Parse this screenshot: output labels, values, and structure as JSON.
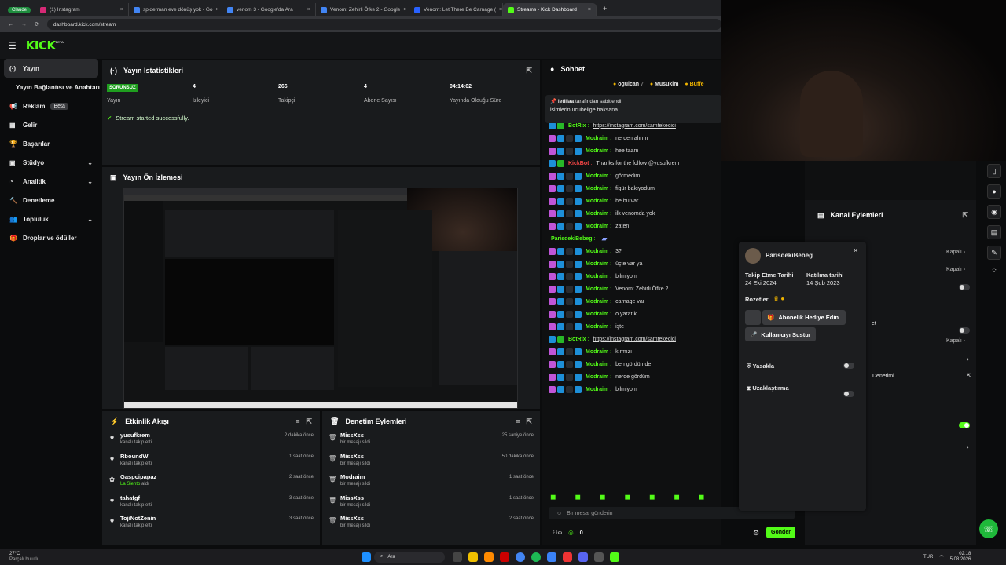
{
  "browser": {
    "tabs": [
      {
        "label": "Claude",
        "color": "#1e8e3e",
        "group": true
      },
      {
        "label": "(1) Instagram",
        "color": "#d62976"
      },
      {
        "label": "spiderman eve dönüş yok - Go",
        "color": "#4285f4"
      },
      {
        "label": "venom 3 - Google'da Ara",
        "color": "#4285f4"
      },
      {
        "label": "Venom: Zehirli Öfke 2 - Google",
        "color": "#4285f4"
      },
      {
        "label": "Venom: Let There Be Carnage (",
        "color": "#2962ff"
      },
      {
        "label": "Streams - Kick Dashboard",
        "color": "#53fc18",
        "active": true
      }
    ],
    "url": "dashboard.kick.com/stream"
  },
  "brand": {
    "logo": "KICK",
    "beta": "BETA",
    "accent": "#53fc18"
  },
  "sidebar": {
    "items": [
      {
        "label": "Yayın",
        "icon": "broadcast-icon",
        "active": true
      },
      {
        "label": "Yayın Bağlantısı ve Anahtarı",
        "icon": ""
      },
      {
        "label": "Reklam",
        "icon": "megaphone-icon",
        "badge": "Beta"
      },
      {
        "label": "Gelir",
        "icon": "money-icon"
      },
      {
        "label": "Başarılar",
        "icon": "trophy-icon"
      },
      {
        "label": "Stüdyo",
        "icon": "studio-icon",
        "chevron": true
      },
      {
        "label": "Analitik",
        "icon": "analytics-icon",
        "chevron": true
      },
      {
        "label": "Denetleme",
        "icon": "hammer-icon"
      },
      {
        "label": "Topluluk",
        "icon": "community-icon",
        "chevron": true
      },
      {
        "label": "Droplar ve ödüller",
        "icon": "gift-icon"
      }
    ]
  },
  "stats": {
    "title": "Yayın İstatistikleri",
    "status_badge": "SORUNSUZ",
    "items": [
      {
        "value": "",
        "label": "Yayın"
      },
      {
        "value": "4",
        "label": "İzleyici"
      },
      {
        "value": "266",
        "label": "Takipçi"
      },
      {
        "value": "4",
        "label": "Abone Sayısı"
      },
      {
        "value": "04:14:02",
        "label": "Yayında Olduğu Süre"
      }
    ],
    "success": "Stream started successfully."
  },
  "preview": {
    "title": "Yayın Ön İzlemesi"
  },
  "feed": {
    "title": "Etkinlik Akışı",
    "rows": [
      {
        "name": "yusufkrem",
        "sub": "kanalı takip etti",
        "time": "2 dakika önce",
        "icon": "heart-icon"
      },
      {
        "name": "RboundW",
        "sub": "kanalı takip etti",
        "time": "1 saat önce",
        "icon": "heart-icon"
      },
      {
        "name": "Gaspcipapaz",
        "sub": "La Siento",
        "sub2": "aldı",
        "time": "2 saat önce",
        "icon": "gift-icon"
      },
      {
        "name": "tahafgf",
        "sub": "kanalı takip etti",
        "time": "3 saat önce",
        "icon": "heart-icon"
      },
      {
        "name": "TojiNotZenin",
        "sub": "kanalı takip etti",
        "time": "3 saat önce",
        "icon": "heart-icon"
      }
    ]
  },
  "mod": {
    "title": "Denetim Eylemleri",
    "rows": [
      {
        "name": "MissXss",
        "sub": "bir mesajı sildi",
        "time": "25 saniye önce"
      },
      {
        "name": "MissXss",
        "sub": "bir mesajı sildi",
        "time": "50 dakika önce"
      },
      {
        "name": "Modraim",
        "sub": "bir mesajı sildi",
        "time": "1 saat önce"
      },
      {
        "name": "MissXss",
        "sub": "bir mesajı sildi",
        "time": "1 saat önce"
      },
      {
        "name": "MissXss",
        "sub": "bir mesajı sildi",
        "time": "2 saat önce"
      }
    ]
  },
  "chat": {
    "title": "Sohbet",
    "top_users": [
      "ogulcan",
      "Musukim",
      "Buffe"
    ],
    "top_counts": [
      "7",
      ""
    ],
    "pinned_by": "letlilaa",
    "pinned_label": "tarafından sabitlendi",
    "pinned_text": "isimlerin ucubelige baksana",
    "messages": [
      {
        "user": "BotRix",
        "text": "https://instagram.com/samtekecici",
        "link": true,
        "badges": [
          "b2",
          "b4"
        ]
      },
      {
        "user": "Modraim",
        "text": "nerden alırım",
        "badges": [
          "b1",
          "b2",
          "b3",
          "b2"
        ]
      },
      {
        "user": "Modraim",
        "text": "hee taam",
        "badges": [
          "b1",
          "b2",
          "b3",
          "b2"
        ]
      },
      {
        "user": "KickBot",
        "text": "Thanks for the follow @yusufkrem",
        "red": true,
        "badges": [
          "b2",
          "b4"
        ]
      },
      {
        "user": "Modraim",
        "text": "görmedim",
        "badges": [
          "b1",
          "b2",
          "b3",
          "b2"
        ]
      },
      {
        "user": "Modraim",
        "text": "figür bakıyodum",
        "badges": [
          "b1",
          "b2",
          "b3",
          "b2"
        ]
      },
      {
        "user": "Modraim",
        "text": "he bu var",
        "badges": [
          "b1",
          "b2",
          "b3",
          "b2"
        ]
      },
      {
        "user": "Modraim",
        "text": "ilk venomda yok",
        "badges": [
          "b1",
          "b2",
          "b3",
          "b2"
        ]
      },
      {
        "user": "Modraim",
        "text": "zaten",
        "badges": [
          "b1",
          "b2",
          "b3",
          "b2"
        ]
      },
      {
        "user": "ParisdekiBebeg",
        "text": "",
        "badges": []
      },
      {
        "user": "Modraim",
        "text": "3?",
        "badges": [
          "b1",
          "b2",
          "b3",
          "b2"
        ]
      },
      {
        "user": "Modraim",
        "text": "üçte var ya",
        "badges": [
          "b1",
          "b2",
          "b3",
          "b2"
        ]
      },
      {
        "user": "Modraim",
        "text": "bilmiyom",
        "badges": [
          "b1",
          "b2",
          "b3",
          "b2"
        ]
      },
      {
        "user": "Modraim",
        "text": "Venom: Zehirli Öfke 2",
        "badges": [
          "b1",
          "b2",
          "b3",
          "b2"
        ]
      },
      {
        "user": "Modraim",
        "text": "carnage var",
        "badges": [
          "b1",
          "b2",
          "b3",
          "b2"
        ]
      },
      {
        "user": "Modraim",
        "text": "o yaratık",
        "badges": [
          "b1",
          "b2",
          "b3",
          "b2"
        ]
      },
      {
        "user": "Modraim",
        "text": "işte",
        "badges": [
          "b1",
          "b2",
          "b3",
          "b2"
        ]
      },
      {
        "user": "BotRix",
        "text": "https://instagram.com/samtekecici",
        "link": true,
        "badges": [
          "b2",
          "b4"
        ]
      },
      {
        "user": "Modraim",
        "text": "kırmızı",
        "badges": [
          "b1",
          "b2",
          "b3",
          "b2"
        ]
      },
      {
        "user": "Modraim",
        "text": "ben gördümde",
        "badges": [
          "b1",
          "b2",
          "b3",
          "b2"
        ]
      },
      {
        "user": "Modraim",
        "text": "nerde gördüm",
        "badges": [
          "b1",
          "b2",
          "b3",
          "b2"
        ]
      },
      {
        "user": "Modraim",
        "text": "bilmiyom",
        "badges": [
          "b1",
          "b2",
          "b3",
          "b2"
        ]
      }
    ],
    "placeholder": "Bir mesaj gönderin",
    "send": "Gönder",
    "points": "0"
  },
  "right_panel": {
    "title": "Kanal Eylemleri",
    "off_label": "Kapalı",
    "partial_1": "et",
    "partial_2": "Denetimi"
  },
  "user_card": {
    "username": "ParisdekiBebeg",
    "follow_label": "Takip Etme Tarihi",
    "follow_date": "24 Eki 2024",
    "join_label": "Katılma tarihi",
    "join_date": "14 Şub 2023",
    "badges_label": "Rozetler",
    "gift_sub": "Abonelik Hediye Edin",
    "mute": "Kullanıcıyı Sustur",
    "ban": "Yasakla",
    "timeout": "Uzaklaştırma"
  },
  "taskbar": {
    "weather_temp": "27°C",
    "weather_desc": "Parçalı bulutlu",
    "search": "Ara",
    "lang": "TUR",
    "time": "02:18",
    "date": "5.08.2026"
  }
}
